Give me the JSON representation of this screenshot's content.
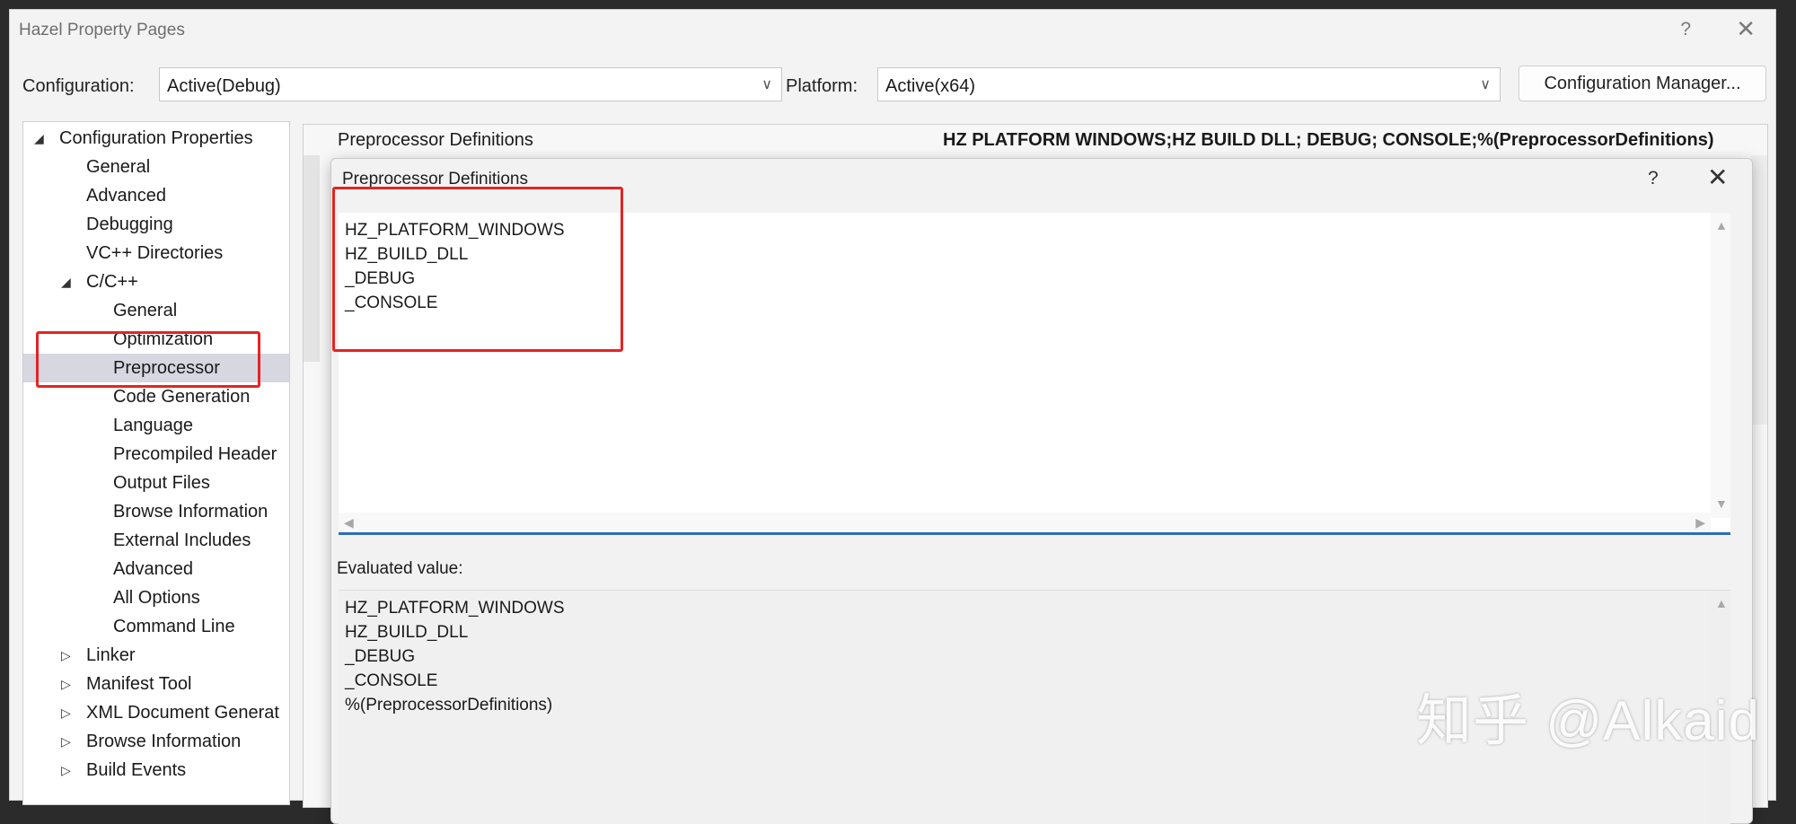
{
  "window": {
    "title": "Hazel Property Pages",
    "help": "?",
    "close": "✕"
  },
  "config": {
    "configuration_label": "Configuration:",
    "configuration_value": "Active(Debug)",
    "platform_label": "Platform:",
    "platform_value": "Active(x64)",
    "manager_button": "Configuration Manager..."
  },
  "tree": {
    "items": [
      {
        "label": "Configuration Properties",
        "expanded": true
      },
      {
        "label": "General"
      },
      {
        "label": "Advanced"
      },
      {
        "label": "Debugging"
      },
      {
        "label": "VC++ Directories"
      },
      {
        "label": "C/C++",
        "expanded": true
      },
      {
        "label": "General"
      },
      {
        "label": "Optimization"
      },
      {
        "label": "Preprocessor",
        "selected": true
      },
      {
        "label": "Code Generation"
      },
      {
        "label": "Language"
      },
      {
        "label": "Precompiled Header"
      },
      {
        "label": "Output Files"
      },
      {
        "label": "Browse Information"
      },
      {
        "label": "External Includes"
      },
      {
        "label": "Advanced"
      },
      {
        "label": "All Options"
      },
      {
        "label": "Command Line"
      },
      {
        "label": "Linker",
        "expanded": false
      },
      {
        "label": "Manifest Tool",
        "expanded": false
      },
      {
        "label": "XML Document Generat",
        "expanded": false
      },
      {
        "label": "Browse Information",
        "expanded": false
      },
      {
        "label": "Build Events",
        "expanded": false
      }
    ]
  },
  "property_row": {
    "name": "Preprocessor Definitions",
    "value": "HZ PLATFORM WINDOWS;HZ BUILD DLL; DEBUG; CONSOLE;%(PreprocessorDefinitions)"
  },
  "dialog": {
    "title": "Preprocessor Definitions",
    "help": "?",
    "close": "✕",
    "definitions": [
      "HZ_PLATFORM_WINDOWS",
      "HZ_BUILD_DLL",
      "_DEBUG",
      "_CONSOLE"
    ],
    "evaluated_label": "Evaluated value:",
    "evaluated": [
      "HZ_PLATFORM_WINDOWS",
      "HZ_BUILD_DLL",
      "_DEBUG",
      "_CONSOLE",
      "%(PreprocessorDefinitions)"
    ]
  },
  "watermark": "知乎 @Alkaid",
  "colors": {
    "highlight": "#e22525",
    "selection": "#d6d7e0",
    "edit_underline": "#2c6fb0"
  }
}
